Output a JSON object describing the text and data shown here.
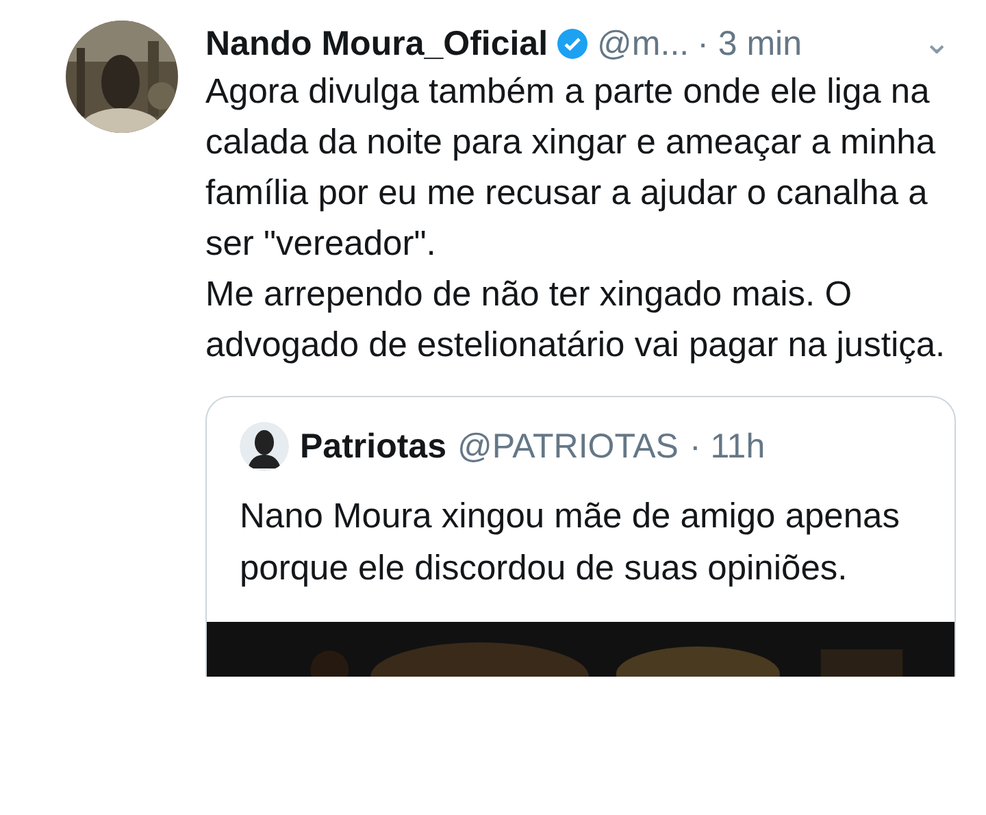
{
  "tweet": {
    "name": "Nando Moura_Oficial",
    "verified": true,
    "handle": "@m...",
    "time": "· 3 min",
    "menu": "⌄",
    "paragraphs": [
      "Agora divulga também a parte onde ele liga na calada da noite para xingar e ameaçar a minha família por eu me recusar a ajudar o canalha a ser \"vereador\".",
      "Me arrependo de não ter xingado mais. O advogado de estelionatário vai pagar na justiça."
    ],
    "quoted": {
      "name": "Patriotas",
      "handle": "@PATRIOTAS",
      "time": "· 11h",
      "text": "Nano Moura xingou mãe de amigo apenas porque ele discordou de suas opiniões."
    }
  }
}
